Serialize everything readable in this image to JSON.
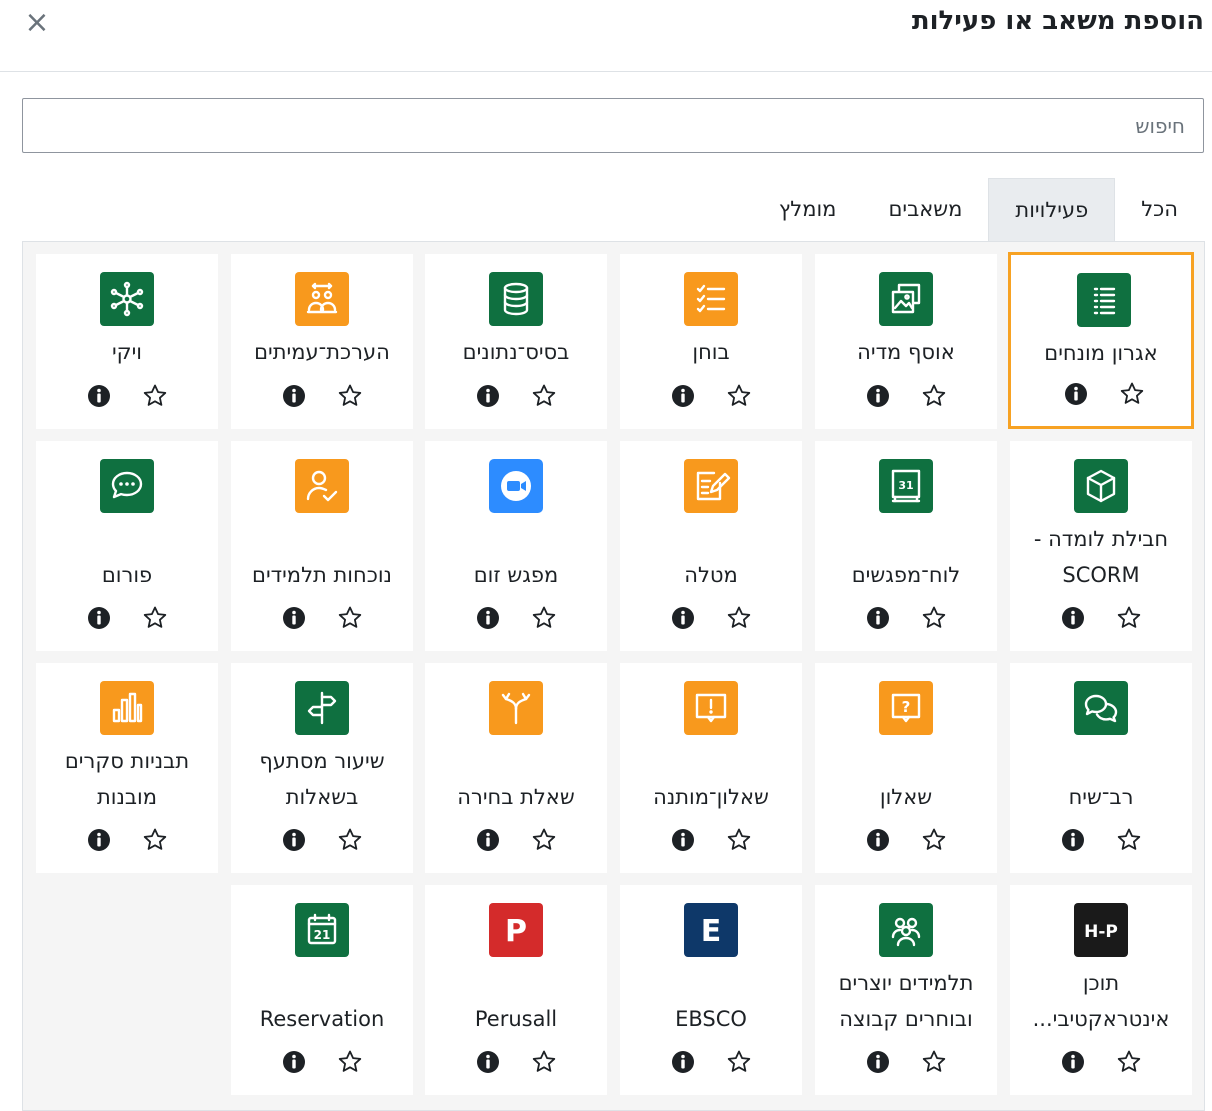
{
  "dialog": {
    "title": "הוספת משאב או פעילות",
    "close_symbol": "×"
  },
  "search": {
    "placeholder": "חיפוש"
  },
  "tabs": [
    {
      "label": "הכל",
      "active": false
    },
    {
      "label": "פעילויות",
      "active": true
    },
    {
      "label": "משאבים",
      "active": false
    },
    {
      "label": "מומלץ",
      "active": false
    }
  ],
  "colors": {
    "green": "#0f7040",
    "orange": "#f8991d",
    "blue": "#2d8cff",
    "red": "#d42b2b",
    "navy": "#0e3869",
    "black": "#1a1a1a",
    "selected_border": "#f7a223"
  },
  "modules": [
    {
      "name": "אגרון מונחים",
      "icon": "glossary-icon",
      "color": "green",
      "selected": true
    },
    {
      "name": "אוסף מדיה",
      "icon": "media-collection-icon",
      "color": "green"
    },
    {
      "name": "בוחן",
      "icon": "quiz-icon",
      "color": "orange"
    },
    {
      "name": "בסיס־נתונים",
      "icon": "database-icon",
      "color": "green"
    },
    {
      "name": "הערכת־עמיתים",
      "icon": "workshop-icon",
      "color": "orange"
    },
    {
      "name": "ויקי",
      "icon": "wiki-icon",
      "color": "green"
    },
    {
      "name": "חבילת לומדה - SCORM",
      "icon": "scorm-package-icon",
      "color": "green"
    },
    {
      "name": "לוח־מפגשים",
      "icon": "scheduler-icon",
      "color": "green"
    },
    {
      "name": "מטלה",
      "icon": "assignment-icon",
      "color": "orange"
    },
    {
      "name": "מפגש זום",
      "icon": "zoom-icon",
      "color": "blue"
    },
    {
      "name": "נוכחות תלמידים",
      "icon": "attendance-icon",
      "color": "orange"
    },
    {
      "name": "פורום",
      "icon": "forum-icon",
      "color": "green"
    },
    {
      "name": "רב־שיח",
      "icon": "chat-icon",
      "color": "green"
    },
    {
      "name": "שאלון",
      "icon": "feedback-icon",
      "color": "orange"
    },
    {
      "name": "שאלון־מותנה",
      "icon": "questionnaire-icon",
      "color": "orange"
    },
    {
      "name": "שאלת בחירה",
      "icon": "choice-icon",
      "color": "orange"
    },
    {
      "name": "שיעור מסתעף בשאלות",
      "icon": "lesson-icon",
      "color": "green"
    },
    {
      "name": "תבניות סקרים מובנות",
      "icon": "survey-icon",
      "color": "orange"
    },
    {
      "name": "תוכן אינטראקטיבי...",
      "icon": "h5p-icon",
      "color": "black",
      "symbol": "H-P"
    },
    {
      "name": "תלמידים יוצרים ובוחרים קבוצה",
      "icon": "group-choice-icon",
      "color": "green"
    },
    {
      "name": "EBSCO",
      "icon": "ebsco-icon",
      "color": "navy",
      "symbol": "E"
    },
    {
      "name": "Perusall",
      "icon": "perusall-icon",
      "color": "red",
      "symbol": "P"
    },
    {
      "name": "Reservation",
      "icon": "reservation-icon",
      "color": "green",
      "symbol": "21"
    }
  ]
}
